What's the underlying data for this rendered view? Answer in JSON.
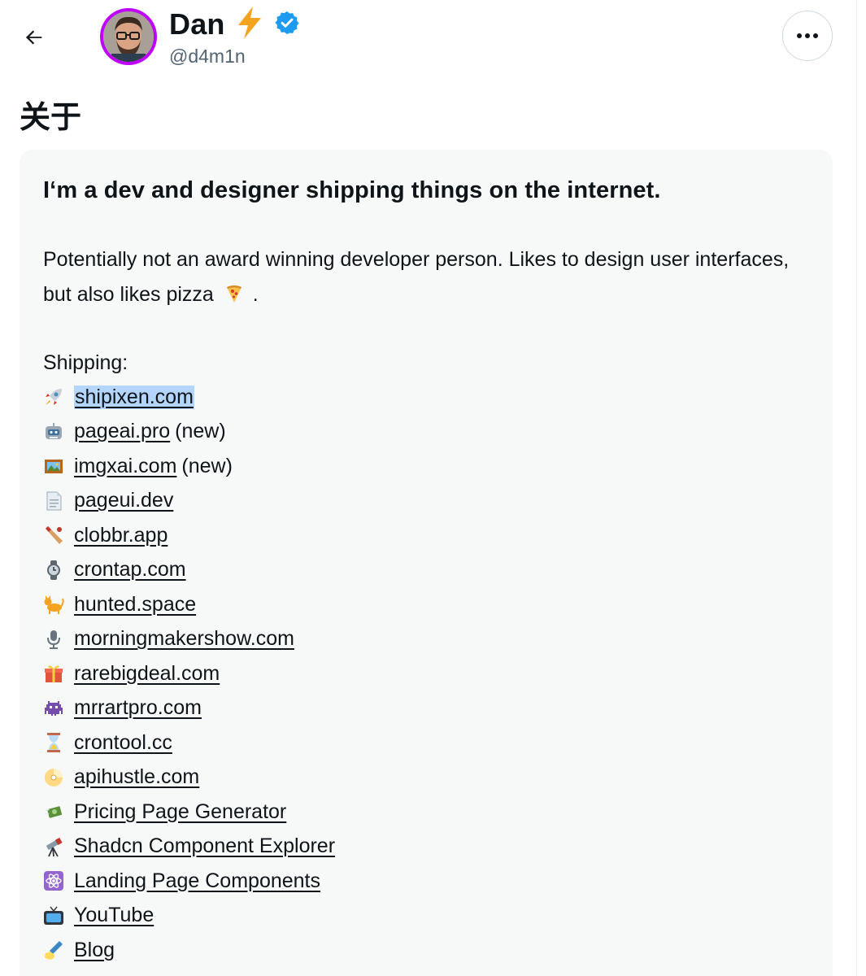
{
  "header": {
    "back_icon": "arrow-left-icon",
    "display_name": "Dan",
    "name_badges": [
      "lightning-emoji-icon",
      "verified-badge-icon"
    ],
    "verified_color": "#1d9bf0",
    "avatar_ring_color": "#c000ff",
    "handle": "@d4m1n",
    "more_icon": "more-horizontal-icon"
  },
  "section": {
    "title": "关于"
  },
  "about": {
    "headline": "I‘m a dev and designer shipping things on the internet.",
    "bio_line_1": "Potentially not an award winning developer person.  Likes to design user interfaces,",
    "bio_line_2": "but also likes pizza",
    "bio_line_2_emoji": "pizza-emoji-icon",
    "bio_line_2_end": ".",
    "shipping_label": "Shipping:",
    "links": [
      {
        "icon": "rocket-emoji-icon",
        "label": "shipixen.com",
        "suffix": "",
        "highlighted": true
      },
      {
        "icon": "robot-emoji-icon",
        "label": "pageai.pro",
        "suffix": "(new)",
        "highlighted": false
      },
      {
        "icon": "framed-picture-emoji-icon",
        "label": "imgxai.com",
        "suffix": "(new)",
        "highlighted": false
      },
      {
        "icon": "page-document-emoji-icon",
        "label": "pageui.dev",
        "suffix": "",
        "highlighted": false
      },
      {
        "icon": "cricket-bat-emoji-icon",
        "label": "clobbr.app",
        "suffix": "",
        "highlighted": false
      },
      {
        "icon": "watch-emoji-icon",
        "label": "crontap.com",
        "suffix": "",
        "highlighted": false
      },
      {
        "icon": "cat-emoji-icon",
        "label": "hunted.space",
        "suffix": "",
        "highlighted": false
      },
      {
        "icon": "microphone-emoji-icon",
        "label": "morningmakershow.com",
        "suffix": "",
        "highlighted": false
      },
      {
        "icon": "gift-emoji-icon",
        "label": "rarebigdeal.com",
        "suffix": "",
        "highlighted": false
      },
      {
        "icon": "space-invader-emoji-icon",
        "label": "mrrartpro.com",
        "suffix": "",
        "highlighted": false
      },
      {
        "icon": "hourglass-emoji-icon",
        "label": "crontool.cc",
        "suffix": "",
        "highlighted": false
      },
      {
        "icon": "cd-disc-emoji-icon",
        "label": "apihustle.com",
        "suffix": "",
        "highlighted": false
      },
      {
        "icon": "money-wings-emoji-icon",
        "label": "Pricing Page Generator",
        "suffix": "",
        "highlighted": false
      },
      {
        "icon": "telescope-emoji-icon",
        "label": "Shadcn Component Explorer",
        "suffix": "",
        "highlighted": false
      },
      {
        "icon": "atom-emoji-icon",
        "label": "Landing Page Components",
        "suffix": "",
        "highlighted": false
      },
      {
        "icon": "television-emoji-icon",
        "label": "YouTube",
        "suffix": "",
        "highlighted": false
      },
      {
        "icon": "writing-hand-emoji-icon",
        "label": "Blog",
        "suffix": "",
        "highlighted": false
      }
    ]
  }
}
